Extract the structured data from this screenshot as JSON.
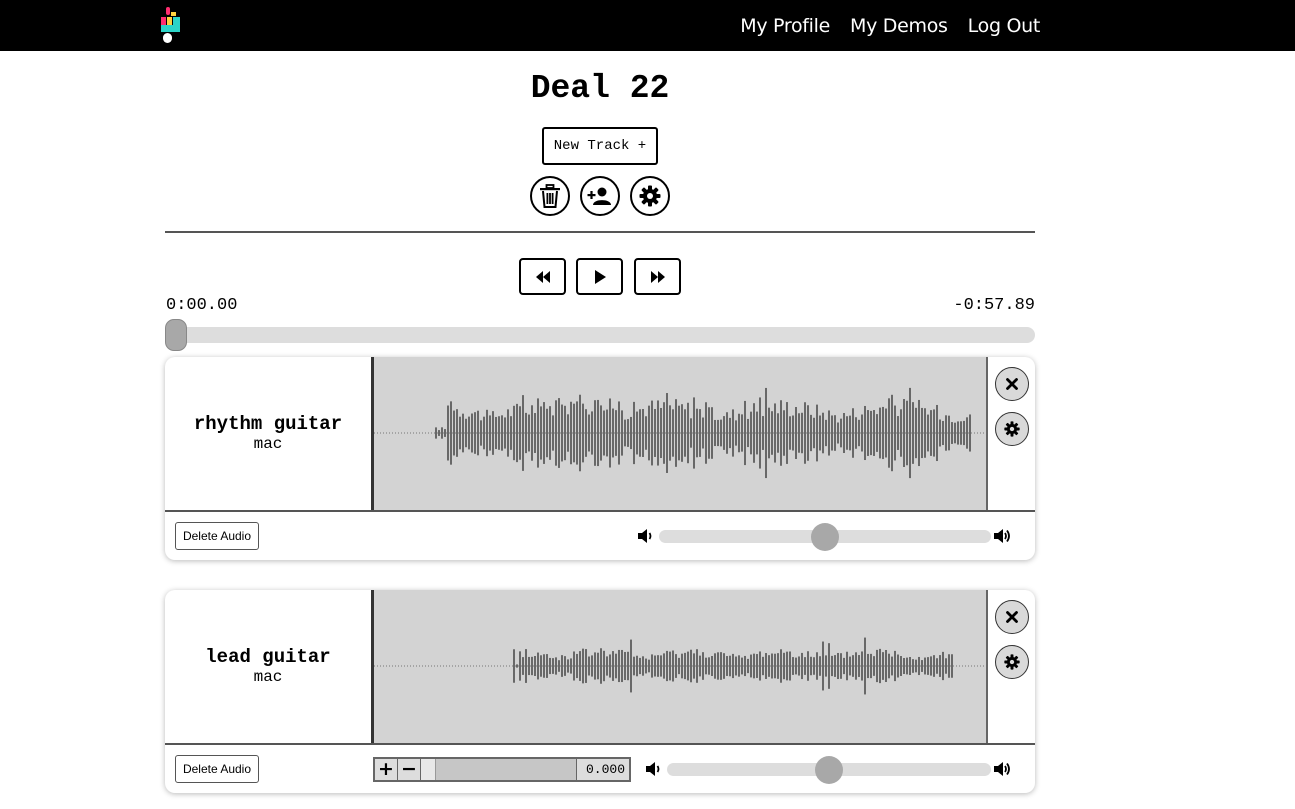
{
  "nav": {
    "links": [
      "My Profile",
      "My Demos",
      "Log Out"
    ],
    "logo_colors": [
      "#ff2d6f",
      "#2ad4c8",
      "#ffd23f"
    ]
  },
  "demo": {
    "title": "Deal 22",
    "new_track_label": "New Track +",
    "icons": [
      "trash-icon",
      "add-user-icon",
      "gear-icon"
    ]
  },
  "transport": {
    "elapsed": "0:00.00",
    "remaining": "-0:57.89",
    "position": 0,
    "buttons": [
      "rewind-icon",
      "play-icon",
      "fast-forward-icon"
    ]
  },
  "tracks": [
    {
      "name": "rhythm guitar",
      "user": "mac",
      "delete_label": "Delete Audio",
      "volume": 0.5,
      "show_offset": false
    },
    {
      "name": "lead guitar",
      "user": "mac",
      "delete_label": "Delete Audio",
      "volume": 0.5,
      "show_offset": true,
      "offset_plus": "+",
      "offset_minus": "−",
      "offset_value": "0.000"
    }
  ],
  "colors": {
    "navbar": "#000000",
    "waveform_bg": "#d3d3d3",
    "waveform": "#000000",
    "slider_track": "#dddddd",
    "slider_thumb": "#a8a8a8"
  }
}
